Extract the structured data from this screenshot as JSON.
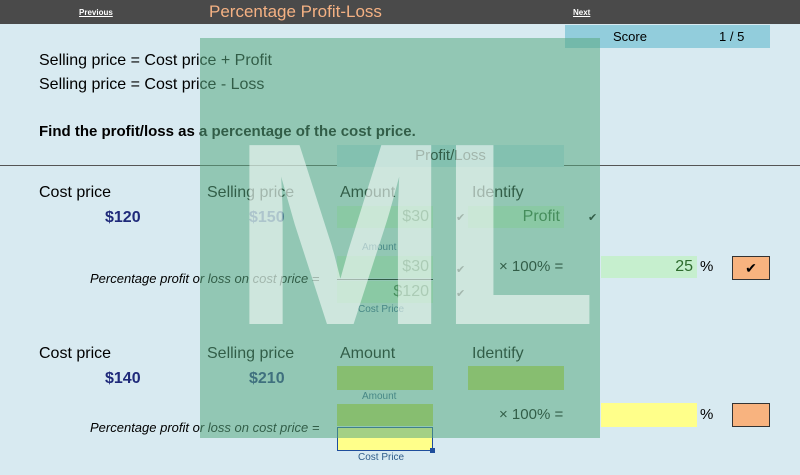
{
  "header": {
    "previous_label": "Previous",
    "title": "Percentage Profit-Loss",
    "next_label": "Next"
  },
  "score": {
    "label": "Score",
    "value": "1 / 5"
  },
  "formulas": {
    "line1": "Selling price = Cost price + Profit",
    "line2": "Selling price = Cost price - Loss"
  },
  "question": "Find the profit/loss as a percentage of the cost price.",
  "profit_loss_header": "Profit/Loss",
  "columns": {
    "cost_price": "Cost price",
    "selling_price": "Selling price",
    "amount": "Amount",
    "identify": "Identify"
  },
  "problem1": {
    "cost_price": "$120",
    "selling_price": "$150",
    "amount": "$30",
    "amount_check": "✔",
    "identify": "Profit",
    "identify_check": "✔",
    "amount_label": "Amount",
    "numerator": "$30",
    "numerator_check": "✔",
    "denominator": "$120",
    "denominator_check": "✔",
    "cost_label": "Cost Price",
    "percentage_label": "Percentage profit or loss on cost price =",
    "multiplier": "× 100% =",
    "result": "25",
    "percent_sign": "%",
    "check_button": "✔"
  },
  "problem2": {
    "cost_price": "$140",
    "selling_price": "$210",
    "amount": "",
    "identify": "",
    "amount_label": "Amount",
    "numerator": "",
    "denominator": "",
    "cost_label": "Cost Price",
    "percentage_label": "Percentage profit or loss on cost price =",
    "multiplier": "× 100% =",
    "result": "",
    "percent_sign": "%",
    "check_button": ""
  },
  "watermark": "ML",
  "colors": {
    "top_bar": "#4a4a4a",
    "title": "#f4b183",
    "background": "#d8eaf1",
    "score_box": "#92cddc",
    "correct_cell": "#c6efce",
    "input_cell": "#bfd75c",
    "answer_cell": "#ffff8a",
    "check_button": "#f8b37f",
    "watermark_overlay": "#5aaa82"
  }
}
